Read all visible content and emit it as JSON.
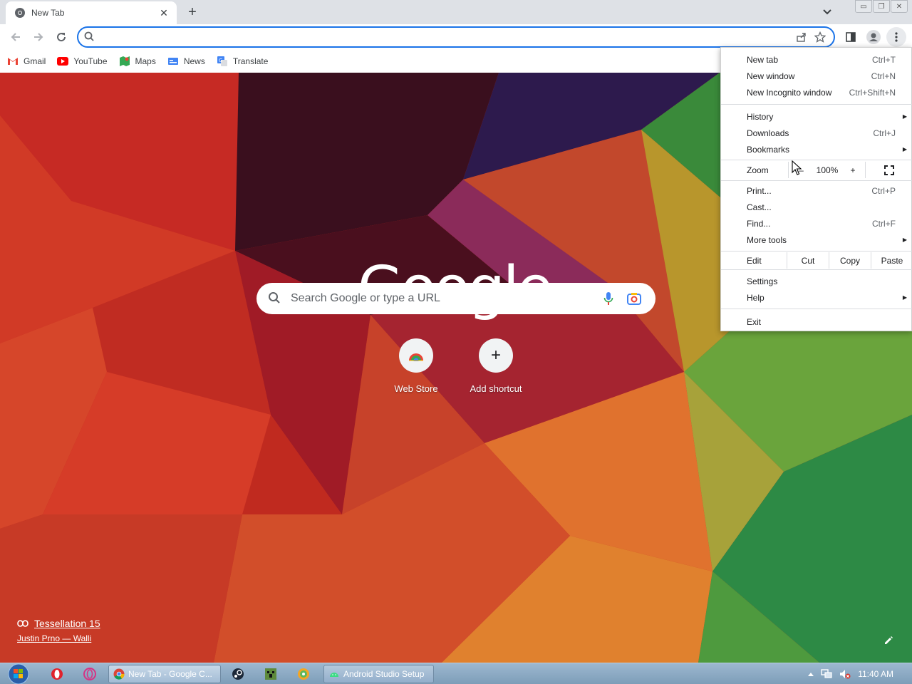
{
  "browser": {
    "tab": {
      "title": "New Tab",
      "icon": "chrome-icon"
    },
    "window_controls": [
      "minimize",
      "restore",
      "close"
    ]
  },
  "toolbar": {
    "omnibox": {
      "value": "",
      "placeholder": ""
    }
  },
  "bookmarks": [
    {
      "label": "Gmail",
      "icon": "gmail-icon",
      "color": "#ea4335"
    },
    {
      "label": "YouTube",
      "icon": "youtube-icon",
      "color": "#ff0000"
    },
    {
      "label": "Maps",
      "icon": "maps-icon",
      "color": "#34a853"
    },
    {
      "label": "News",
      "icon": "news-icon",
      "color": "#4285f4"
    },
    {
      "label": "Translate",
      "icon": "translate-icon",
      "color": "#4285f4"
    }
  ],
  "ntp": {
    "logo": "Google",
    "search_placeholder": "Search Google or type a URL",
    "shortcuts": [
      {
        "label": "Web Store",
        "icon": "webstore-icon"
      },
      {
        "label": "Add shortcut",
        "icon": "plus-icon"
      }
    ],
    "attribution": {
      "title": "Tessellation 15",
      "author": "Justin Prno — Walli"
    }
  },
  "menu": {
    "items_group1": [
      {
        "label": "New tab",
        "shortcut": "Ctrl+T"
      },
      {
        "label": "New window",
        "shortcut": "Ctrl+N"
      },
      {
        "label": "New Incognito window",
        "shortcut": "Ctrl+Shift+N"
      }
    ],
    "items_group2": [
      {
        "label": "History",
        "shortcut": "",
        "submenu": true
      },
      {
        "label": "Downloads",
        "shortcut": "Ctrl+J",
        "submenu": false
      },
      {
        "label": "Bookmarks",
        "shortcut": "",
        "submenu": true
      }
    ],
    "zoom": {
      "label": "Zoom",
      "minus": "–",
      "value": "100%",
      "plus": "+"
    },
    "items_group3": [
      {
        "label": "Print...",
        "shortcut": "Ctrl+P",
        "submenu": false
      },
      {
        "label": "Cast...",
        "shortcut": "",
        "submenu": false
      },
      {
        "label": "Find...",
        "shortcut": "Ctrl+F",
        "submenu": false
      },
      {
        "label": "More tools",
        "shortcut": "",
        "submenu": true
      }
    ],
    "edit": {
      "label": "Edit",
      "cut": "Cut",
      "copy": "Copy",
      "paste": "Paste"
    },
    "items_group4": [
      {
        "label": "Settings",
        "submenu": false
      },
      {
        "label": "Help",
        "submenu": true
      }
    ],
    "exit": "Exit"
  },
  "taskbar": {
    "tasks": [
      {
        "label": "New Tab - Google C...",
        "icon": "chrome-icon"
      },
      {
        "label": "Android Studio Setup",
        "icon": "android-icon"
      }
    ],
    "clock": "11:40 AM"
  },
  "colors": {
    "accent": "#1a73e8",
    "menu_bg": "#ffffff",
    "taskbar": "#8aa7c2"
  }
}
